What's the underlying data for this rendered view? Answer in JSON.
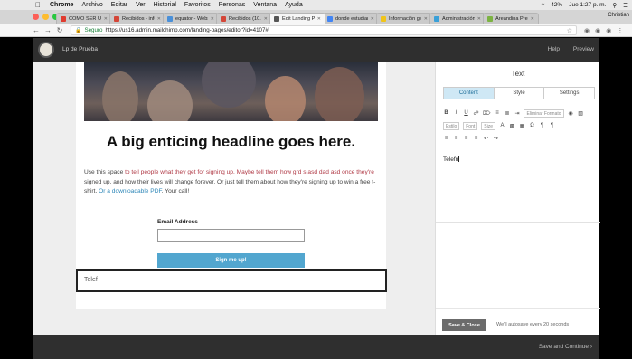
{
  "menubar": {
    "apple": "",
    "app": "Chrome",
    "items": [
      "Archivo",
      "Editar",
      "Ver",
      "Historial",
      "Favoritos",
      "Personas",
      "Ventana",
      "Ayuda"
    ],
    "battery": "42%",
    "clock": "Jue 1:27 p. m."
  },
  "tabs": [
    {
      "title": "CÓMO SER Un",
      "color": "#e03b2f",
      "active": false
    },
    {
      "title": "Recibidos - info",
      "color": "#d44638",
      "active": false
    },
    {
      "title": "equator - Websi",
      "color": "#4a90d9",
      "active": false
    },
    {
      "title": "Recibidos (10.6",
      "color": "#d44638",
      "active": false
    },
    {
      "title": "Edit Landing Pa",
      "color": "#555555",
      "active": true
    },
    {
      "title": "donde estudiar",
      "color": "#4285f4",
      "active": false
    },
    {
      "title": "Información ge",
      "color": "#f0c419",
      "active": false
    },
    {
      "title": "Administración",
      "color": "#3aa0d8",
      "active": false
    },
    {
      "title": "Areandina Pres",
      "color": "#7cb342",
      "active": false
    }
  ],
  "profile": "Christian",
  "address": {
    "secure_label": "Seguro",
    "url": "https://us16.admin.mailchimp.com/landing-pages/editor?id=4107#"
  },
  "app_header": {
    "title": "Lp de Prueba",
    "help": "Help",
    "preview": "Preview"
  },
  "page": {
    "headline": "A big enticing headline goes here.",
    "body_plain_1": "Use this space ",
    "body_red": "to tell people what they get for signing up. Maybe tell them how grd s asd dad asd once they're",
    "body_plain_2": " signed up, and how their lives will change forever. Or just tell them about how they're signing up to win a free t-shirt. ",
    "body_link": "Or a downloadable PDF",
    "body_plain_3": ". Your call!",
    "email_label": "Email Address",
    "signup_button": "Sign me up!",
    "selected_text": "Telef"
  },
  "panel": {
    "title": "Text",
    "tabs": [
      "Content",
      "Style",
      "Settings"
    ],
    "active_tab": "Content",
    "clear_format": "Eliminar Formato",
    "style_select": "Estilo",
    "font_select": "Font",
    "size_select": "Size",
    "editor_text": "Telefn",
    "save_button": "Save & Close",
    "autosave": "We'll autosave every 20 seconds"
  },
  "footer": {
    "save_continue": "Save and Continue"
  },
  "colors": {
    "accent_blue": "#52a6cf",
    "active_tab_bg": "#cfe8f5",
    "header_bg": "#2f2f2f",
    "red_text": "#b03a46"
  }
}
